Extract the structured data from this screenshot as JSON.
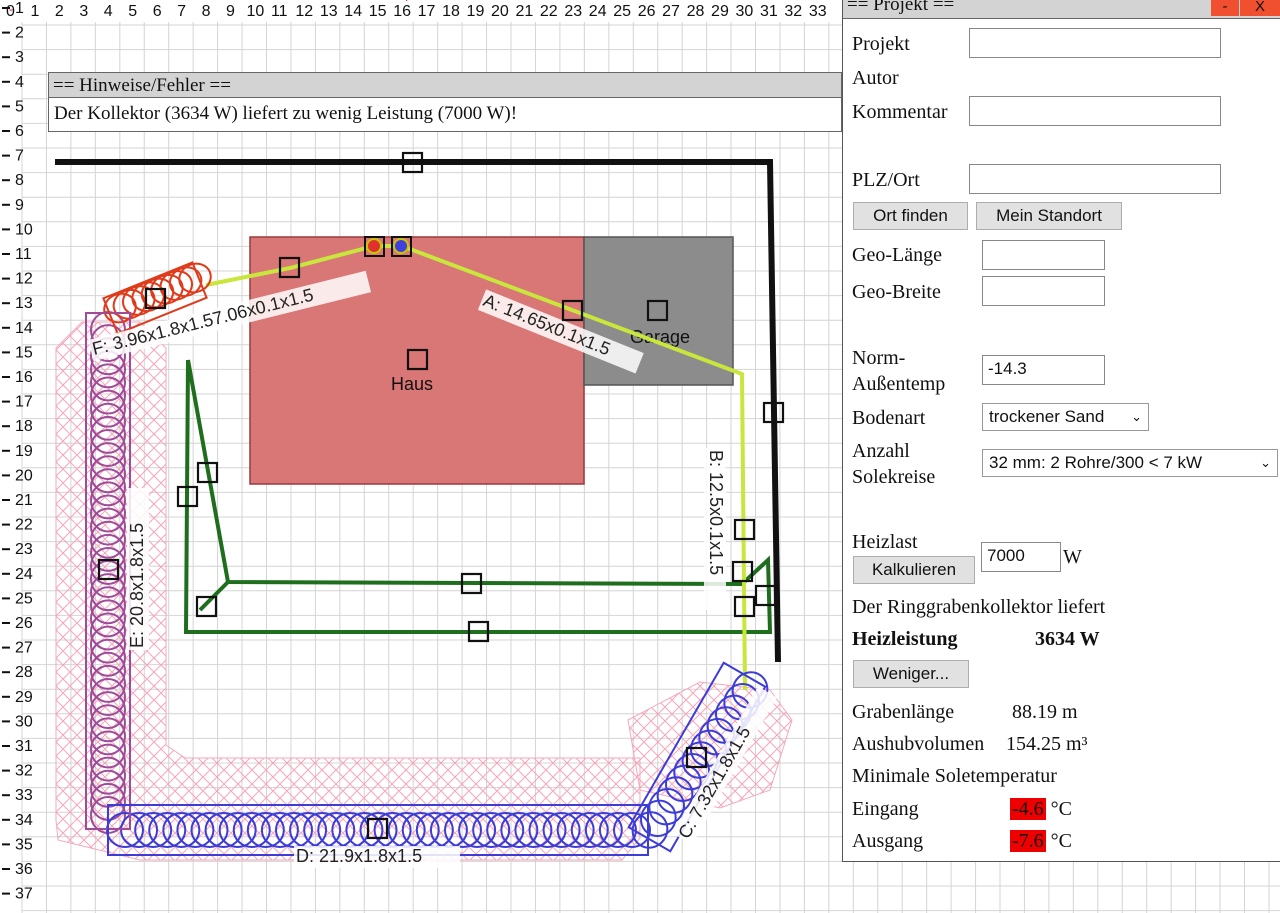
{
  "ruler": {
    "top": [
      "0",
      "1",
      "2",
      "3",
      "4",
      "5",
      "6",
      "7",
      "8",
      "9",
      "10",
      "11",
      "12",
      "13",
      "14",
      "15",
      "16",
      "17",
      "18",
      "19",
      "20",
      "21",
      "22",
      "23",
      "24",
      "25",
      "26",
      "27",
      "28",
      "29",
      "30",
      "31",
      "32",
      "33"
    ],
    "left": [
      "1",
      "2",
      "3",
      "4",
      "5",
      "6",
      "7",
      "8",
      "9",
      "10",
      "11",
      "12",
      "13",
      "14",
      "15",
      "16",
      "17",
      "18",
      "19",
      "20",
      "21",
      "22",
      "23",
      "24",
      "25",
      "26",
      "27",
      "28",
      "29",
      "30",
      "31",
      "32",
      "33",
      "34",
      "35",
      "36",
      "37"
    ]
  },
  "plan": {
    "house_label": "Haus",
    "garage_label": "Garage",
    "segments": {
      "A": "A: 14.65x0.1x1.5",
      "B": "B: 12.5x0.1x1.5",
      "C": "C: 7.32x1.8x1.5",
      "D": "D: 21.9x1.8x1.5",
      "E": "E: 20.8x1.8x1.5",
      "F": "F: 3.96x1.8x1.57.06x0.1x1.5"
    }
  },
  "hints": {
    "title": "== Hinweise/Fehler ==",
    "message": "Der Kollektor (3634 W) liefert zu wenig Leistung (7000 W)!"
  },
  "project": {
    "title": "== Projekt ==",
    "minimize": "-",
    "close": "X",
    "projekt_label": "Projekt",
    "projekt_value": "",
    "autor_label": "Autor",
    "kommentar_label": "Kommentar",
    "kommentar_value": "",
    "plz_label": "PLZ/Ort",
    "plz_value": "",
    "btn_ort_finden": "Ort finden",
    "btn_mein_standort": "Mein Standort",
    "geo_laenge_label": "Geo-Länge",
    "geo_laenge_value": "",
    "geo_breite_label": "Geo-Breite",
    "geo_breite_value": "",
    "norm_label_1": "Norm-",
    "norm_label_2": "Außentemp",
    "norm_value": "-14.3",
    "bodenart_label": "Bodenart",
    "bodenart_value": "trockener Sand",
    "anzahl_label_1": "Anzahl",
    "anzahl_label_2": "Solekreise",
    "anzahl_value": "32 mm: 2 Rohre/300 < 7 kW",
    "heizlast_label": "Heizlast",
    "btn_kalkulieren": "Kalkulieren",
    "heizlast_value": "7000",
    "heizlast_unit": "W",
    "liefert_text": "Der Ringgrabenkollektor liefert",
    "heizleistung_label": "Heizleistung",
    "heizleistung_value": "3634 W",
    "btn_weniger": "Weniger...",
    "grabenlaenge_label": "Grabenlänge",
    "grabenlaenge_value": "88.19 m",
    "aushub_label": "Aushubvolumen",
    "aushub_value": "154.25 m³",
    "min_sole_label": "Minimale Soletemperatur",
    "eingang_label": "Eingang",
    "eingang_value": "-4.6",
    "ausgang_label": "Ausgang",
    "ausgang_value": "-7.6",
    "temp_unit": "°C"
  },
  "colors": {
    "house": "#d97676",
    "garage": "#8c8c8c",
    "supply_line": "#c8e63c",
    "green_loop": "#1e6e1e",
    "purple_coil": "#a04a9a",
    "blue_coil": "#3c3cd8",
    "red_coil": "#e03a1a",
    "pink_hatch": "#f4a0b4",
    "cold_temp": "#ee0000"
  }
}
